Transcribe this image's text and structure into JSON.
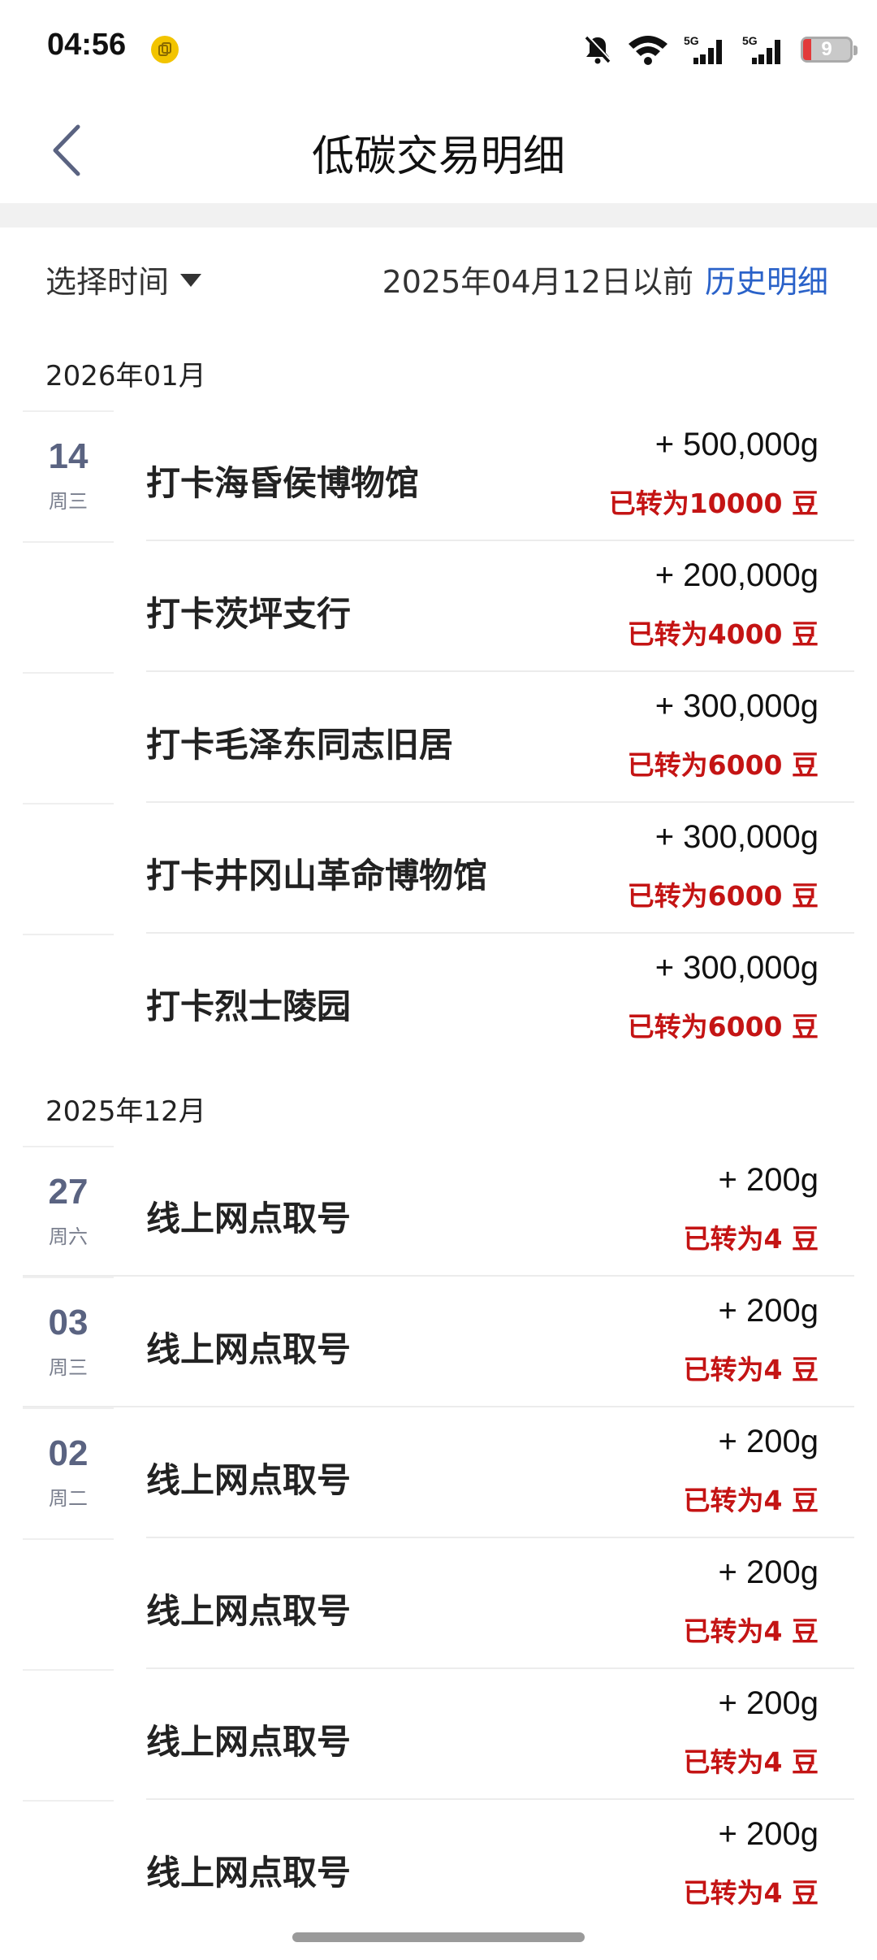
{
  "status_bar": {
    "time": "04:56",
    "battery": "9",
    "signal_1": "5G",
    "signal_2": "5G"
  },
  "header": {
    "title": "低碳交易明细"
  },
  "filter": {
    "select_time": "选择时间",
    "before_date": "2025年04月12日以前",
    "history_link": "历史明细"
  },
  "groups": [
    {
      "month": "2026年01月",
      "rows": [
        {
          "day": "14",
          "weekday": "周三",
          "title": "打卡海昏侯博物馆",
          "amount": "+ 500,000g",
          "note": "已转为10000 豆"
        },
        {
          "day": "",
          "weekday": "",
          "title": "打卡茨坪支行",
          "amount": "+ 200,000g",
          "note": "已转为4000 豆"
        },
        {
          "day": "",
          "weekday": "",
          "title": "打卡毛泽东同志旧居",
          "amount": "+ 300,000g",
          "note": "已转为6000 豆"
        },
        {
          "day": "",
          "weekday": "",
          "title": "打卡井冈山革命博物馆",
          "amount": "+ 300,000g",
          "note": "已转为6000 豆"
        },
        {
          "day": "",
          "weekday": "",
          "title": "打卡烈士陵园",
          "amount": "+ 300,000g",
          "note": "已转为6000 豆"
        }
      ]
    },
    {
      "month": "2025年12月",
      "rows": [
        {
          "day": "27",
          "weekday": "周六",
          "title": "线上网点取号",
          "amount": "+ 200g",
          "note": "已转为4 豆"
        },
        {
          "day": "03",
          "weekday": "周三",
          "title": "线上网点取号",
          "amount": "+ 200g",
          "note": "已转为4 豆"
        },
        {
          "day": "02",
          "weekday": "周二",
          "title": "线上网点取号",
          "amount": "+ 200g",
          "note": "已转为4 豆"
        },
        {
          "day": "",
          "weekday": "",
          "title": "线上网点取号",
          "amount": "+ 200g",
          "note": "已转为4 豆"
        },
        {
          "day": "",
          "weekday": "",
          "title": "线上网点取号",
          "amount": "+ 200g",
          "note": "已转为4 豆"
        },
        {
          "day": "",
          "weekday": "",
          "title": "线上网点取号",
          "amount": "+ 200g",
          "note": "已转为4 豆"
        }
      ]
    }
  ],
  "colors": {
    "accent_link": "#2a62c9",
    "note_red": "#c41414",
    "date_blue_gray": "#5a6381"
  },
  "icons": [
    "back-arrow-icon",
    "caret-down-icon",
    "mute-icon",
    "wifi-icon",
    "signal-icon",
    "battery-icon",
    "app-notification-icon"
  ]
}
